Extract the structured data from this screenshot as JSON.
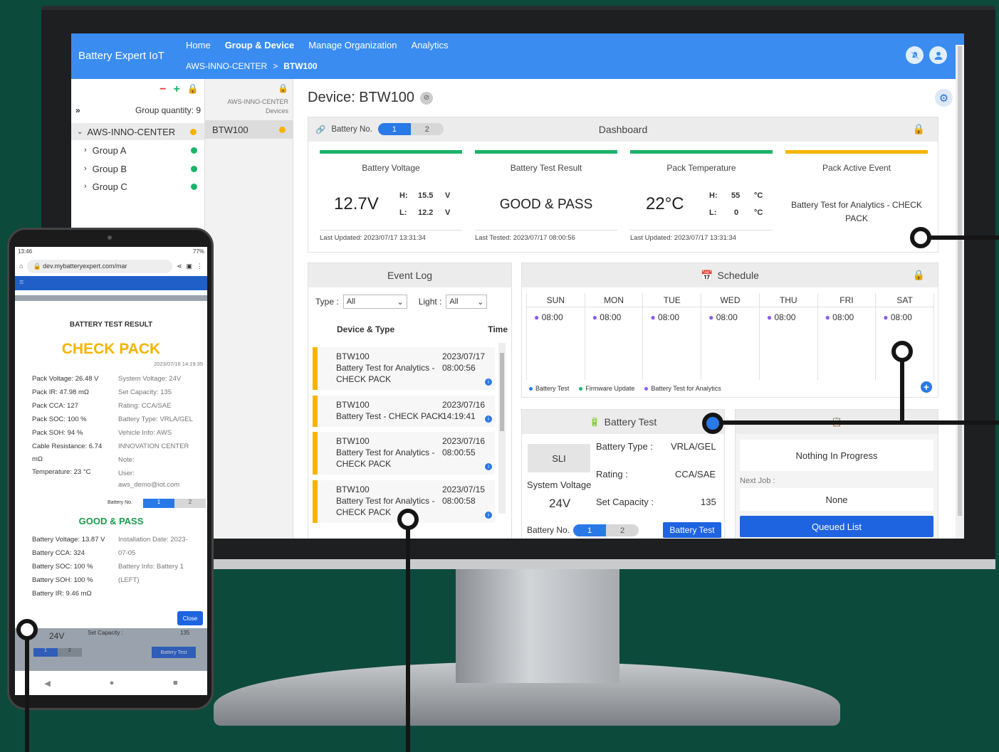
{
  "app": {
    "brand": "Battery Expert IoT"
  },
  "nav": {
    "home": "Home",
    "group_device": "Group & Device",
    "manage_org": "Manage Organization",
    "analytics": "Analytics"
  },
  "breadcrumb": {
    "org": "AWS-INNO-CENTER",
    "sep": ">",
    "device": "BTW100"
  },
  "sidebar": {
    "minus": "−",
    "plus": "+",
    "expand": "»",
    "group_quantity": "Group quantity: 9",
    "org": "AWS-INNO-CENTER",
    "groups": [
      "Group A",
      "Group B",
      "Group C"
    ],
    "devices_title": "AWS-INNO-CENTER",
    "devices_sub": "Devices",
    "device": "BTW100"
  },
  "device": {
    "title": "Device: BTW100"
  },
  "dashboard": {
    "battery_no_label": "Battery No.",
    "tabs": [
      "1",
      "2"
    ],
    "title": "Dashboard",
    "voltage": {
      "title": "Battery Voltage",
      "value": "12.7V",
      "h_label": "H:",
      "h": "15.5",
      "l_label": "L:",
      "l": "12.2",
      "unit": "V",
      "updated": "Last Updated: 2023/07/17 13:31:34"
    },
    "result": {
      "title": "Battery Test Result",
      "value": "GOOD & PASS",
      "tested": "Last Tested: 2023/07/17 08:00:56"
    },
    "temp": {
      "title": "Pack Temperature",
      "value": "22°C",
      "h_label": "H:",
      "h": "55",
      "l_label": "L:",
      "l": "0",
      "unit": "°C",
      "updated": "Last Updated: 2023/07/17 13:31:34"
    },
    "event": {
      "title": "Pack Active Event",
      "value": "Battery Test for Analytics - CHECK PACK"
    }
  },
  "event_log": {
    "title": "Event Log",
    "type_label": "Type :",
    "type_value": "All",
    "light_label": "Light :",
    "light_value": "All",
    "col_device": "Device & Type",
    "col_time": "Time",
    "rows": [
      {
        "device": "BTW100",
        "type": "Battery Test for Analytics - CHECK PACK",
        "date": "2023/07/17",
        "time": "08:00:56"
      },
      {
        "device": "BTW100",
        "type": "Battery Test - CHECK PACK",
        "date": "2023/07/16",
        "time": "14:19:41"
      },
      {
        "device": "BTW100",
        "type": "Battery Test for Analytics - CHECK PACK",
        "date": "2023/07/16",
        "time": "08:00:55"
      },
      {
        "device": "BTW100",
        "type": "Battery Test for Analytics - CHECK PACK",
        "date": "2023/07/15",
        "time": "08:00:58"
      }
    ]
  },
  "schedule": {
    "title": "Schedule",
    "days": [
      "SUN",
      "MON",
      "TUE",
      "WED",
      "THU",
      "FRI",
      "SAT"
    ],
    "time": "08:00",
    "legend": [
      "Battery Test",
      "Firmware Update",
      "Battery Test for Analytics"
    ],
    "legend_colors": [
      "#2979e6",
      "#1bb36a",
      "#8a5cf0"
    ]
  },
  "battery_test": {
    "title": "Battery Test",
    "sli": "SLI",
    "system_voltage_label": "System Voltage",
    "system_voltage": "24V",
    "type_label": "Battery Type :",
    "type": "VRLA/GEL",
    "rating_label": "Rating :",
    "rating": "CCA/SAE",
    "capacity_label": "Set Capacity :",
    "capacity": "135",
    "battery_no_label": "Battery No.",
    "button": "Battery Test"
  },
  "jobs": {
    "in_progress": "Nothing In Progress",
    "next_label": "Next Job :",
    "next": "None",
    "queued": "Queued List"
  },
  "phone": {
    "status_time": "13:46",
    "status_battery": "77%",
    "url": "dev.mybatteryexpert.com/mar",
    "result_title": "BATTERY TEST RESULT",
    "headline": "CHECK PACK",
    "timestamp": "2023/07/16 14:19:35",
    "left_lines": [
      "Pack Voltage: 26.48 V",
      "Pack IR: 47.98 mΩ",
      "Pack CCA: 127",
      "Pack SOC: 100 %",
      "Pack SOH: 94 %",
      "Cable Resistance: 6.74",
      "mΩ",
      "Temperature: 23 °C"
    ],
    "right_lines": [
      "System Voltage: 24V",
      "Set Capacity: 135",
      "Rating: CCA/SAE",
      "Battery Type: VRLA/GEL",
      "Vehicle Info: AWS",
      "INNOVATION CENTER",
      "Note:",
      "User:",
      "aws_demo@iot.com"
    ],
    "battery_no_label": "Battery No.",
    "good": "GOOD & PASS",
    "b_left": [
      "Battery Voltage: 13.87 V",
      "Battery CCA: 324",
      "Battery SOC: 100 %",
      "Battery SOH: 100 %",
      "Battery IR: 9.46 mΩ"
    ],
    "b_right": [
      "Installation Date: 2023-",
      "07-05",
      "Battery Info: Battery 1",
      "(LEFT)"
    ],
    "close": "Close",
    "bg_voltage": "24V",
    "bg_capacity": "Set Capacity :",
    "bg_capacity_val": "135",
    "bg_button": "Battery Test"
  }
}
